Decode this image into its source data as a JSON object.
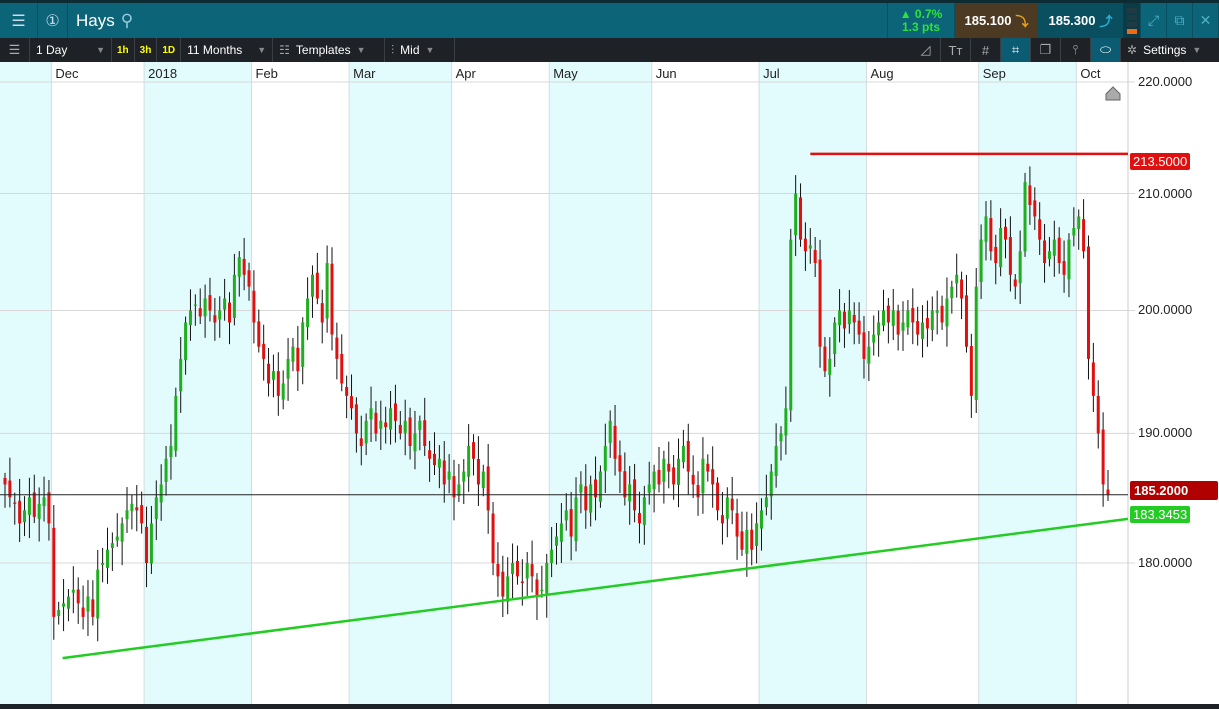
{
  "header": {
    "symbol": "Hays",
    "change_pct": "▲ 0.7%",
    "change_pts": "1.3 pts",
    "sell": "185.100",
    "buy": "185.300"
  },
  "toolbar": {
    "interval": "1 Day",
    "quick": [
      "1h",
      "3h",
      "1D"
    ],
    "range": "11 Months",
    "templates": "Templates",
    "price_type": "Mid",
    "settings": "Settings"
  },
  "colors": {
    "up": "#1fae1f",
    "down": "#e01010",
    "trend_support": "#22cc22",
    "resistance": "#e01010"
  },
  "chart_data": {
    "type": "candlestick",
    "scale": "log",
    "months": [
      "Dec",
      "2018",
      "Feb",
      "Mar",
      "Apr",
      "May",
      "Jun",
      "Jul",
      "Aug",
      "Sep",
      "Oct"
    ],
    "month_candle_counts": [
      10,
      19,
      22,
      20,
      21,
      20,
      21,
      22,
      22,
      23,
      20,
      7
    ],
    "y_ticks": [
      "220.0000",
      "210.0000",
      "200.0000",
      "190.0000",
      "180.0000"
    ],
    "y_tick_values": [
      220,
      210,
      200,
      190,
      180
    ],
    "ylim": [
      172,
      221.5
    ],
    "closes": [
      186,
      185,
      184.5,
      183,
      184,
      185,
      183.5,
      184.5,
      185,
      183,
      176,
      176.5,
      177,
      177.5,
      178,
      177,
      176,
      177.5,
      176,
      179.5,
      180,
      181,
      181.5,
      182,
      183,
      184,
      184.5,
      184,
      183,
      180,
      183,
      185,
      186,
      188,
      189,
      193,
      196,
      199,
      200,
      200.5,
      199.5,
      201,
      200,
      199,
      200,
      201,
      199,
      203,
      204.5,
      203,
      202,
      199,
      197,
      196,
      194,
      195,
      193,
      194,
      196,
      197,
      195,
      199,
      201,
      203,
      201,
      199,
      204,
      198,
      196,
      194,
      193,
      192,
      190,
      189,
      191,
      192,
      190,
      191,
      190.5,
      192,
      191,
      190,
      191,
      189,
      190,
      191,
      189,
      188,
      187.5,
      188,
      186,
      187,
      185,
      186,
      187,
      189,
      188,
      186,
      187,
      184,
      180,
      179,
      177.5,
      179,
      180,
      179,
      178.5,
      180,
      179,
      177.5,
      178,
      180,
      181,
      182,
      183,
      184,
      182,
      185,
      186,
      184,
      186,
      185,
      187,
      189,
      191,
      188,
      187,
      185,
      186,
      184,
      183,
      185,
      186,
      187,
      186,
      188,
      187,
      186,
      188,
      189,
      187,
      186,
      185,
      188,
      187,
      186,
      184,
      183,
      185,
      184,
      182,
      181,
      182.5,
      181,
      183,
      184,
      185,
      187,
      189,
      190,
      192,
      206,
      210,
      206,
      205,
      205.5,
      204,
      197,
      195,
      196,
      199,
      200,
      198.5,
      200,
      199,
      198,
      196,
      197,
      198,
      199,
      200,
      199,
      200,
      198,
      199,
      200,
      199,
      198,
      199,
      198.5,
      200,
      200,
      199,
      201,
      202,
      203,
      201,
      197,
      193,
      202,
      206,
      208,
      205,
      204,
      207,
      206,
      203,
      202,
      205,
      211,
      209,
      208,
      206,
      204,
      205,
      206,
      204,
      203,
      206,
      207,
      208,
      205,
      196,
      193,
      190,
      186,
      185.2
    ],
    "lines": {
      "resistance": {
        "price": 213.5,
        "label": "213.5000",
        "from_candle": 165
      },
      "support": {
        "from_candle": 12,
        "from_price": 173.0,
        "to_price": 183.3453,
        "label": "183.3453"
      },
      "last": {
        "price": 185.2,
        "label": "185.2000"
      }
    }
  }
}
